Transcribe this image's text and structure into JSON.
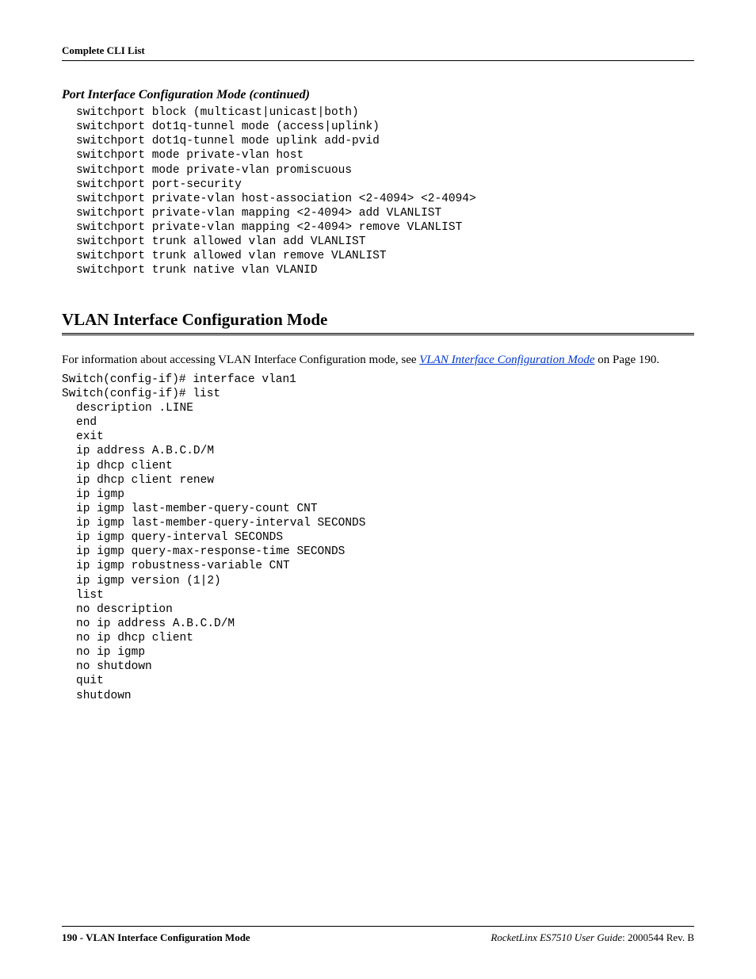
{
  "header": {
    "running_head": "Complete CLI List"
  },
  "section1": {
    "title": "Port Interface Configuration Mode (continued)",
    "code": "switchport block (multicast|unicast|both)\nswitchport dot1q-tunnel mode (access|uplink)\nswitchport dot1q-tunnel mode uplink add-pvid\nswitchport mode private-vlan host\nswitchport mode private-vlan promiscuous\nswitchport port-security\nswitchport private-vlan host-association <2-4094> <2-4094>\nswitchport private-vlan mapping <2-4094> add VLANLIST\nswitchport private-vlan mapping <2-4094> remove VLANLIST\nswitchport trunk allowed vlan add VLANLIST\nswitchport trunk allowed vlan remove VLANLIST\nswitchport trunk native vlan VLANID"
  },
  "section2": {
    "heading": "VLAN Interface Configuration Mode",
    "intro_prefix": "For information about accessing VLAN Interface Configuration mode, see ",
    "link_text": "VLAN Interface Configuration Mode",
    "intro_suffix": " on Page 190.",
    "code_prefix": "Switch(config-if)# interface vlan1\nSwitch(config-if)# list",
    "code_indent": "description .LINE\nend\nexit\nip address A.B.C.D/M\nip dhcp client\nip dhcp client renew\nip igmp\nip igmp last-member-query-count CNT\nip igmp last-member-query-interval SECONDS\nip igmp query-interval SECONDS\nip igmp query-max-response-time SECONDS\nip igmp robustness-variable CNT\nip igmp version (1|2)\nlist\nno description\nno ip address A.B.C.D/M\nno ip dhcp client\nno ip igmp\nno shutdown\nquit\nshutdown"
  },
  "footer": {
    "left": "190 - VLAN Interface Configuration Mode",
    "right_italic": "RocketLinx ES7510  User Guide",
    "right_plain": ": 2000544 Rev. B"
  }
}
